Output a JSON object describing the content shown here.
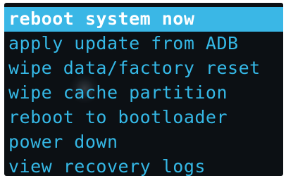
{
  "recovery_menu": {
    "items": [
      {
        "label": "reboot system now",
        "selected": true
      },
      {
        "label": "apply update from ADB",
        "selected": false
      },
      {
        "label": "wipe data/factory reset",
        "selected": false
      },
      {
        "label": "wipe cache partition",
        "selected": false
      },
      {
        "label": "reboot to bootloader",
        "selected": false
      },
      {
        "label": "power down",
        "selected": false
      },
      {
        "label": "view recovery logs",
        "selected": false
      }
    ]
  },
  "colors": {
    "screen_background": "#0c1014",
    "menu_text": "#35b8e6",
    "highlight_background": "#3ab7e6",
    "highlight_text": "#ffffff"
  }
}
